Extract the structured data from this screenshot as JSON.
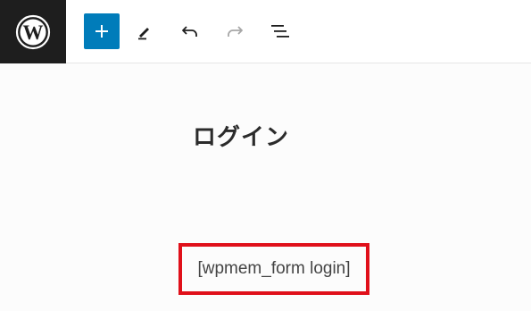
{
  "toolbar": {
    "logo_icon": "wordpress-logo-icon",
    "buttons": [
      {
        "name": "add-block-button",
        "icon": "plus-icon"
      },
      {
        "name": "edit-tool-button",
        "icon": "pencil-icon"
      },
      {
        "name": "undo-button",
        "icon": "undo-icon"
      },
      {
        "name": "redo-button",
        "icon": "redo-icon"
      },
      {
        "name": "document-overview-button",
        "icon": "list-view-icon"
      }
    ],
    "accent_color": "#007cba",
    "logo_bg_color": "#1e1e1e"
  },
  "editor": {
    "page_title": "ログイン",
    "shortcode_text": "[wpmem_form login]",
    "highlight_color": "#e0101a"
  }
}
